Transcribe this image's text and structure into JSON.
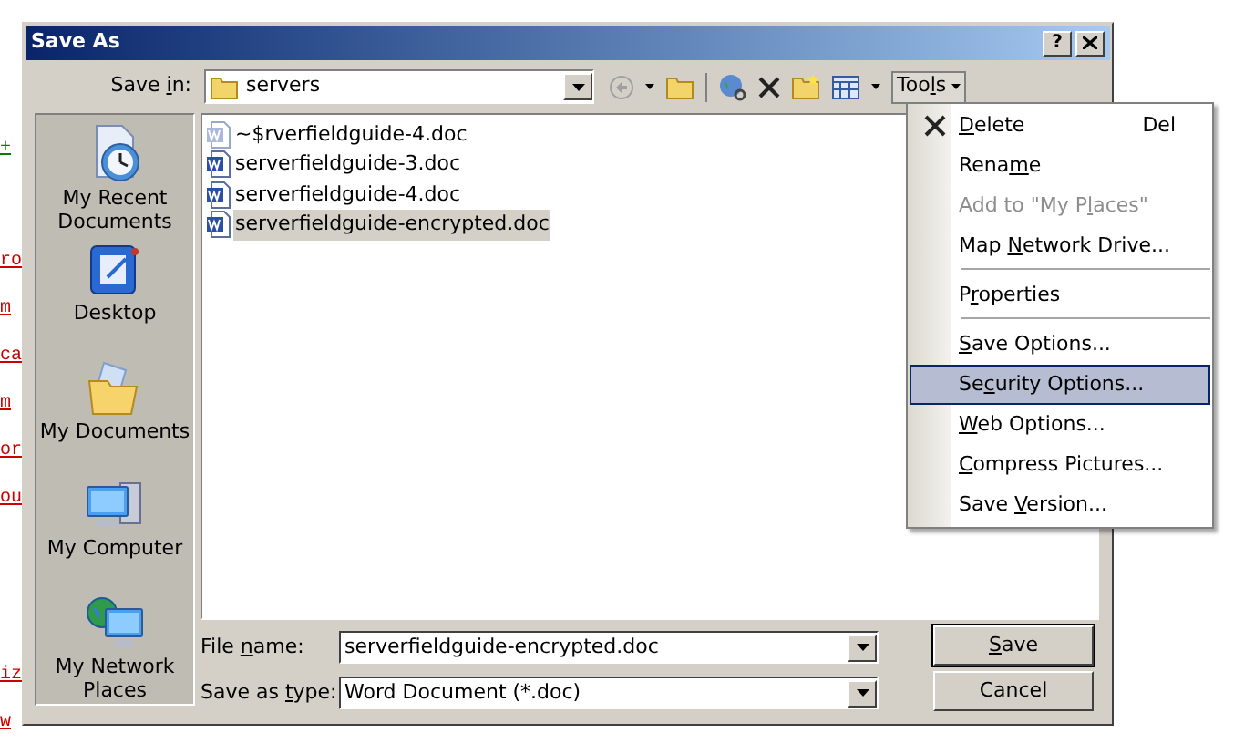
{
  "background_fragments": [
    {
      "text": "+",
      "color": "#008000"
    },
    {
      "text": "ro",
      "color": "#cc0000"
    },
    {
      "text": "m",
      "color": "#cc0000"
    },
    {
      "text": "ca",
      "color": "#cc0000"
    },
    {
      "text": "m",
      "color": "#cc0000"
    },
    {
      "text": "or",
      "color": "#cc0000"
    },
    {
      "text": "ou",
      "color": "#cc0000"
    },
    {
      "text": "iz",
      "color": "#cc0000"
    },
    {
      "text": "w",
      "color": "#cc0000"
    }
  ],
  "window": {
    "title": "Save As",
    "help_button": "?"
  },
  "save_in": {
    "label": {
      "before": "Save ",
      "key": "i",
      "after": "n:"
    },
    "value": "servers"
  },
  "toolbar": {
    "back_disabled": true,
    "tools_button": {
      "label": {
        "before": "Too",
        "key": "l",
        "after": "s"
      },
      "open": true
    }
  },
  "places": [
    {
      "kind": "recent",
      "label": "My Recent Documents"
    },
    {
      "kind": "desktop",
      "label": "Desktop"
    },
    {
      "kind": "documents",
      "label": "My Documents"
    },
    {
      "kind": "computer",
      "label": "My Computer"
    },
    {
      "kind": "network",
      "label": "My Network Places"
    }
  ],
  "files": [
    {
      "name": "~$rverfieldguide-4.doc",
      "kind": "temp",
      "selected": false
    },
    {
      "name": "serverfieldguide-3.doc",
      "kind": "doc",
      "selected": false
    },
    {
      "name": "serverfieldguide-4.doc",
      "kind": "doc",
      "selected": false
    },
    {
      "name": "serverfieldguide-encrypted.doc",
      "kind": "doc",
      "selected": true
    }
  ],
  "file_name": {
    "label": {
      "before": "File ",
      "key": "n",
      "after": "ame:"
    },
    "value": "serverfieldguide-encrypted.doc"
  },
  "save_as_type": {
    "label": {
      "before": "Save as ",
      "key": "t",
      "after": "ype:"
    },
    "value": "Word Document (*.doc)"
  },
  "buttons": [
    {
      "label": {
        "key": "S",
        "after": "ave"
      },
      "default": true
    },
    {
      "label": {
        "before": "Cancel"
      },
      "default": false
    }
  ],
  "tools_menu": [
    {
      "label": {
        "key": "D",
        "after": "elete"
      },
      "shortcut": "Del",
      "icon": true,
      "disabled": false,
      "selected": false,
      "separator_after": false
    },
    {
      "label": {
        "before": "Rena",
        "key": "m",
        "after": "e"
      },
      "icon": false,
      "disabled": false,
      "selected": false,
      "separator_after": false
    },
    {
      "label": {
        "before": "Add to \"My P",
        "key": "l",
        "after": "aces\""
      },
      "icon": false,
      "disabled": true,
      "selected": false,
      "separator_after": false
    },
    {
      "label": {
        "before": "Map ",
        "key": "N",
        "after": "etwork Drive..."
      },
      "icon": false,
      "disabled": false,
      "selected": false,
      "separator_after": true
    },
    {
      "label": {
        "before": "P",
        "key": "r",
        "after": "operties"
      },
      "icon": false,
      "disabled": false,
      "selected": false,
      "separator_after": true
    },
    {
      "label": {
        "key": "S",
        "after": "ave Options..."
      },
      "icon": false,
      "disabled": false,
      "selected": false,
      "separator_after": false
    },
    {
      "label": {
        "before": "Se",
        "key": "c",
        "after": "urity Options..."
      },
      "icon": false,
      "disabled": false,
      "selected": true,
      "separator_after": false
    },
    {
      "label": {
        "key": "W",
        "after": "eb Options..."
      },
      "icon": false,
      "disabled": false,
      "selected": false,
      "separator_after": false
    },
    {
      "label": {
        "key": "C",
        "after": "ompress Pictures..."
      },
      "icon": false,
      "disabled": false,
      "selected": false,
      "separator_after": false
    },
    {
      "label": {
        "before": "Save ",
        "key": "V",
        "after": "ersion..."
      },
      "icon": false,
      "disabled": false,
      "selected": false,
      "separator_after": false
    }
  ]
}
